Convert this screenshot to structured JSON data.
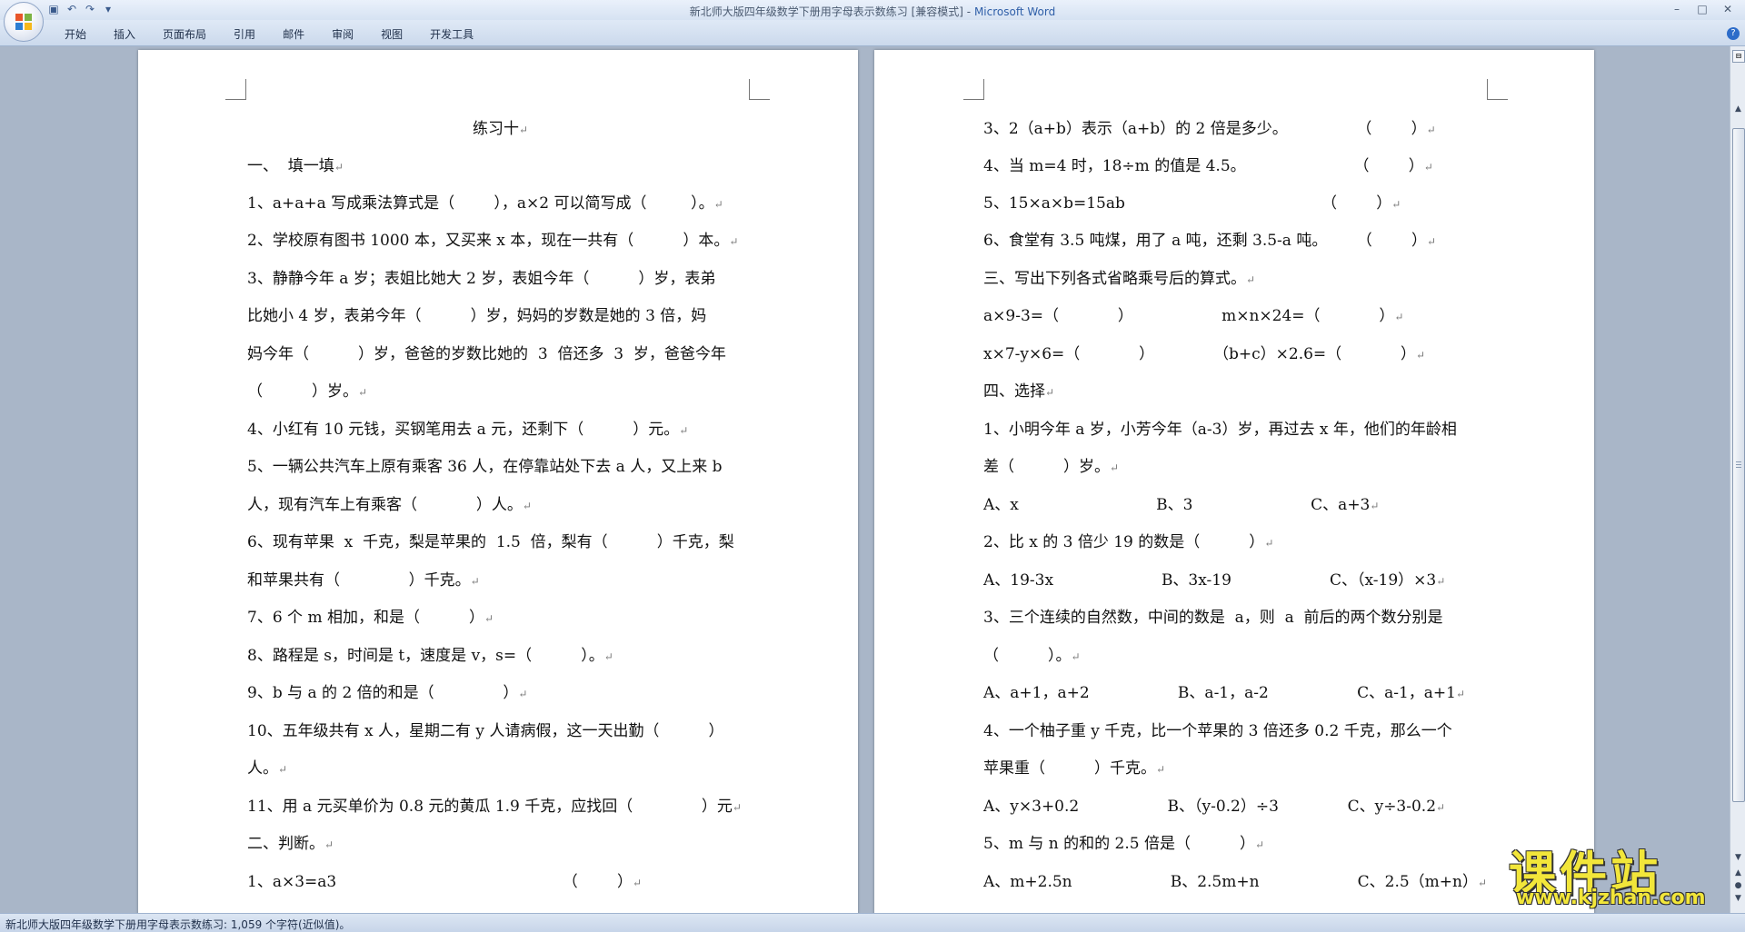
{
  "window": {
    "title": "新北师大版四年级数学下册用字母表示数练习 [兼容模式]",
    "title_sep": " - ",
    "app_name": "Microsoft Word",
    "controls": [
      "–",
      "□",
      "✕"
    ]
  },
  "quick_access": [
    "save-icon",
    "undo-icon",
    "redo-icon",
    "customize-icon"
  ],
  "ribbon": {
    "tabs": [
      "开始",
      "插入",
      "页面布局",
      "引用",
      "邮件",
      "审阅",
      "视图",
      "开发工具"
    ],
    "help": "?"
  },
  "left_page": {
    "lines": [
      "练习十",
      "一、  填一填",
      "1、a+a+a 写成乘法算式是（        ），a×2 可以简写成（         ）。",
      "2、学校原有图书 1000 本，又买来 x 本，现在一共有（          ）本。",
      "3、静静今年 a 岁；表姐比她大 2 岁，表姐今年（          ）岁，表弟",
      "比她小 4 岁，表弟今年（          ）岁，妈妈的岁数是她的 3 倍，妈",
      "妈今年（          ）岁，爸爸的岁数比她的  3  倍还多  3  岁，爸爸今年",
      "（          ）岁。",
      "4、小红有 10 元钱，买钢笔用去 a 元，还剩下（          ）元。",
      "5、一辆公共汽车上原有乘客 36 人，在停靠站处下去 a 人，又上来 b",
      "人，现有汽车上有乘客（            ）人。",
      "6、现有苹果  x  千克，梨是苹果的  1.5  倍，梨有（          ）千克，梨",
      "和苹果共有（              ）千克。",
      "7、6 个 m 相加，和是（          ）",
      "8、路程是 s，时间是 t，速度是 v，s=（          ）。",
      "9、b 与 a 的 2 倍的和是（              ）",
      "10、五年级共有 x 人，星期二有 y 人请病假，这一天出勤（          ）",
      "人。",
      "11、用 a 元买单价为 0.8 元的黄瓜 1.9 千克，应找回（              ）元",
      "二、判断。",
      "1、a×3=a3                                              （        ）"
    ]
  },
  "right_page": {
    "lines": [
      "3、2（a+b）表示（a+b）的 2 倍是多少。              （        ）",
      "4、当 m=4 时，18÷m 的值是 4.5。                      （        ）",
      "5、15×a×b=15ab                                        （        ）",
      "6、食堂有 3.5 吨煤，用了 a 吨，还剩 3.5-a 吨。      （        ）",
      "三、写出下列各式省略乘号后的算式。",
      "a×9-3=（            ）                  m×n×24=（            ）",
      "x×7-y×6=（            ）            （b+c）×2.6=（            ）",
      "四、选择",
      "1、小明今年 a 岁，小芳今年（a-3）岁，再过去 x 年，他们的年龄相",
      "差（          ）岁。",
      "A、x                            B、3                        C、a+3",
      "2、比 x 的 3 倍少 19 的数是（          ）",
      "A、19-3x                      B、3x-19                    C、（x-19）×3",
      "3、三个连续的自然数，中间的数是  a，则  a  前后的两个数分别是",
      "（          ）。",
      "A、a+1，a+2                  B、a-1，a-2                  C、a-1，a+1",
      "4、一个柚子重 y 千克，比一个苹果的 3 倍还多 0.2 千克，那么一个",
      "苹果重（          ）千克。",
      "A、y×3+0.2                  B、（y-0.2）÷3              C、y÷3-0.2",
      "5、m 与 n 的和的 2.5 倍是（          ）",
      "A、m+2.5n                    B、2.5m+n                    C、2.5（m+n）"
    ]
  },
  "status_bar": {
    "text": "新北师大版四年级数学下册用字母表示数练习: 1,059 个字符(近似值)。"
  },
  "watermark": {
    "cn": "课件站",
    "url": "www.kjzhan.com"
  },
  "paragraph_mark": "↵"
}
